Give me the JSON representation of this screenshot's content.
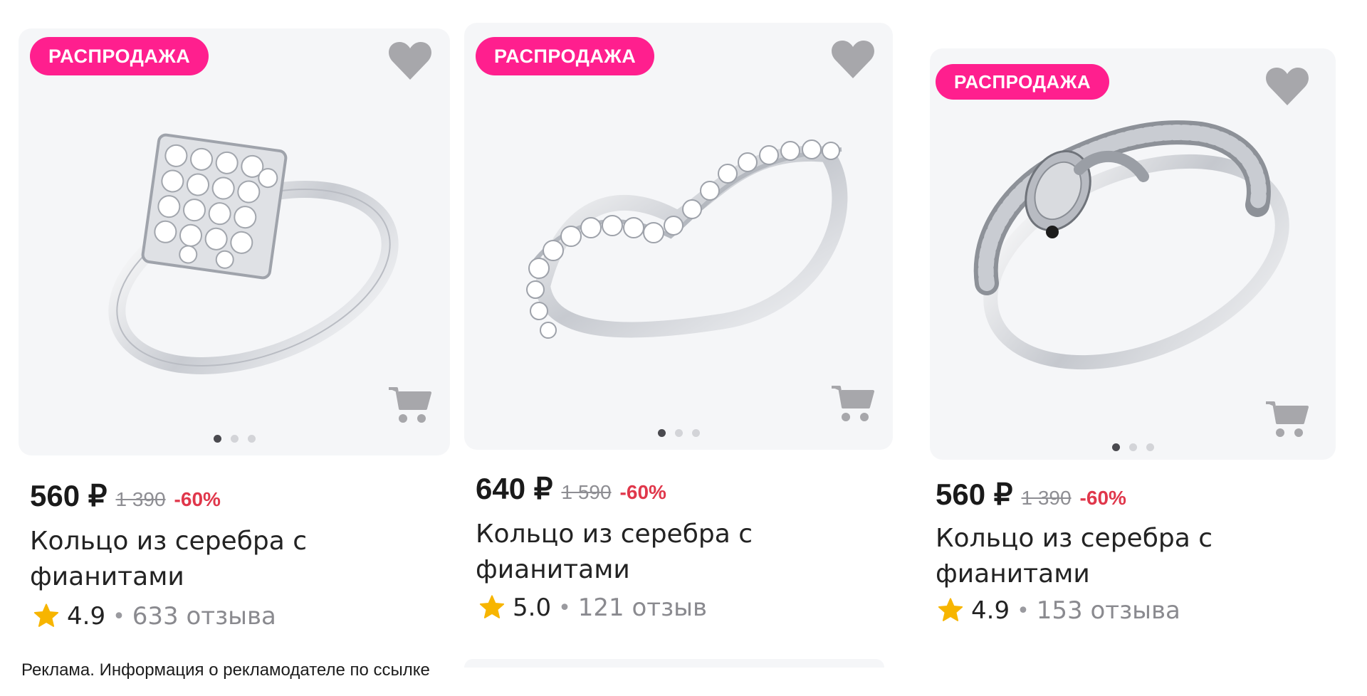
{
  "cards": [
    {
      "badge": "РАСПРОДАЖА",
      "price": "560 ₽",
      "old_price": "1 390",
      "discount": "-60%",
      "title": "Кольцо из серебра с фианитами",
      "rating": "4.9",
      "separator": "•",
      "reviews": "633 отзыва",
      "image_dots": {
        "count": 3,
        "active": 0
      }
    },
    {
      "badge": "РАСПРОДАЖА",
      "price": "640 ₽",
      "old_price": "1 590",
      "discount": "-60%",
      "title": "Кольцо из серебра с фианитами",
      "rating": "5.0",
      "separator": "•",
      "reviews": "121 отзыв",
      "image_dots": {
        "count": 3,
        "active": 0
      }
    },
    {
      "badge": "РАСПРОДАЖА",
      "price": "560 ₽",
      "old_price": "1 390",
      "discount": "-60%",
      "title": "Кольцо из серебра с фианитами",
      "rating": "4.9",
      "separator": "•",
      "reviews": "153 отзыва",
      "image_dots": {
        "count": 3,
        "active": 0
      }
    }
  ],
  "ad_note": "Реклама. Информация о рекламодателе по ссылке",
  "icons": {
    "favorite": "heart-icon",
    "cart": "cart-icon",
    "rating": "star-icon"
  },
  "colors": {
    "badge": "#ff1f8e",
    "discount": "#e0374b",
    "star": "#f7b500",
    "icon_gray": "#a7a7ab"
  }
}
